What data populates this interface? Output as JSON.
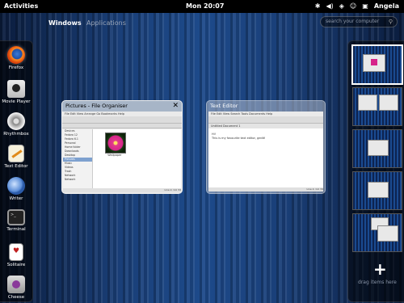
{
  "topbar": {
    "activities": "Activities",
    "clock": "Mon 20:07",
    "user": "Angela",
    "tray_icons": [
      "bluetooth-icon",
      "volume-icon",
      "network-icon",
      "accessibility-icon"
    ]
  },
  "overview": {
    "tabs": [
      "Windows",
      "Applications"
    ],
    "search_placeholder": "search your computer"
  },
  "dash": {
    "items": [
      {
        "label": "Firefox",
        "icon": "firefox-icon"
      },
      {
        "label": "Movie Player",
        "icon": "movie-player-icon"
      },
      {
        "label": "Rhythmbox",
        "icon": "rhythmbox-icon"
      },
      {
        "label": "Text Editor",
        "icon": "text-editor-icon"
      },
      {
        "label": "Writer",
        "icon": "writer-icon"
      },
      {
        "label": "Terminal",
        "icon": "terminal-icon"
      },
      {
        "label": "Solitaire",
        "icon": "solitaire-icon"
      },
      {
        "label": "Cheese",
        "icon": "cheese-icon"
      }
    ]
  },
  "windows": {
    "files": {
      "title": "Pictures - File Organiser",
      "menu": "File  Edit  View  Arrange  Go  Bookmarks  Help",
      "sidebar": [
        "Devices",
        "Fedora 12",
        "Fedora 6.1",
        "Personal",
        "Home folder",
        "Downloads",
        "Desktop",
        "Pictures",
        "Music",
        "Videos",
        "Trash",
        "Network",
        "Network"
      ],
      "file_name": "Wallpaper",
      "status": "Line 2, Col 34"
    },
    "editor": {
      "title": "Text Editor",
      "menu": "File  Edit  View  Search  Tools  Documents  Help",
      "tab": "Untitled Document 1",
      "line1": "Hi!",
      "line2": "This is my favourite text editor, gedit!",
      "status": "Line 2, Col 34"
    }
  },
  "workspaces": {
    "count": 6,
    "active_index": 0,
    "add_label": "+",
    "hint": "drag items here"
  },
  "colors": {
    "background": "#1a3f78",
    "topbar": "#000000"
  }
}
